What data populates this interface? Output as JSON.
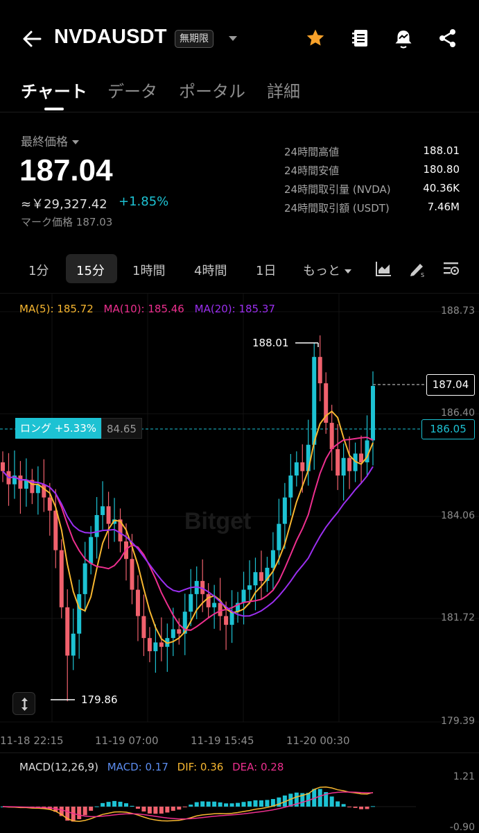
{
  "header": {
    "symbol": "NVDAUSDT",
    "badge": "無期限",
    "icons": [
      "back-arrow-icon",
      "star-icon",
      "notebook-icon",
      "alert-bell-icon",
      "share-icon"
    ]
  },
  "tabs": [
    {
      "label": "チャート",
      "active": true
    },
    {
      "label": "データ",
      "active": false
    },
    {
      "label": "ポータル",
      "active": false
    },
    {
      "label": "詳細",
      "active": false
    }
  ],
  "price": {
    "label": "最終価格",
    "last": "187.04",
    "approx": "≈￥29,327.42",
    "change": "+1.85%",
    "mark_label": "マーク価格",
    "mark_value": "187.03"
  },
  "stats": [
    {
      "label": "24時間高値",
      "value": "188.01"
    },
    {
      "label": "24時間安値",
      "value": "180.80"
    },
    {
      "label": "24時間取引量 (NVDA)",
      "value": "40.36K"
    },
    {
      "label": "24時間取引額 (USDT)",
      "value": "7.46M"
    }
  ],
  "intervals": {
    "items": [
      "1分",
      "15分",
      "1時間",
      "4時間",
      "1日",
      "もっと"
    ],
    "active": "15分"
  },
  "colors": {
    "up": "#1dc2d3",
    "down": "#f0616d",
    "ma5": "#f8b730",
    "ma10": "#ee2f8f",
    "ma20": "#9b2ff0",
    "macd_blue": "#5c8df0"
  },
  "chart": {
    "ma_legend": {
      "ma5": "MA(5): 185.72",
      "ma10": "MA(10): 185.46",
      "ma20": "MA(20): 185.37"
    },
    "y_ticks": [
      "188.73",
      "186.40",
      "184.06",
      "181.72",
      "179.39"
    ],
    "x_ticks": [
      "11-18 22:15",
      "11-19 07:00",
      "11-19 15:45",
      "11-20 00:30"
    ],
    "current_price": "187.04",
    "long_price": "186.05",
    "long_label": "ロング +5.33%",
    "long_qty": "84.65",
    "high_label": "188.01",
    "low_label": "179.86",
    "watermark": "Bitget"
  },
  "macd": {
    "label": "MACD(12,26,9)",
    "macd": "MACD: 0.17",
    "dif": "DIF: 0.36",
    "dea": "DEA: 0.28",
    "y_ticks": [
      "1.21",
      "-0.90"
    ]
  },
  "chart_data": {
    "type": "candlestick",
    "interval": "15分",
    "y_range": [
      179.39,
      188.73
    ],
    "closes": [
      185.1,
      184.8,
      185.0,
      184.7,
      184.9,
      184.6,
      184.8,
      184.5,
      184.2,
      183.3,
      182.0,
      180.9,
      181.4,
      182.3,
      183.0,
      183.6,
      184.1,
      184.3,
      183.9,
      184.0,
      183.5,
      183.1,
      182.4,
      181.8,
      181.3,
      181.0,
      181.2,
      181.1,
      181.3,
      181.5,
      181.4,
      181.9,
      182.3,
      182.6,
      182.3,
      182.0,
      182.1,
      181.8,
      181.6,
      181.9,
      182.1,
      182.4,
      182.5,
      182.8,
      182.6,
      182.9,
      183.3,
      183.9,
      184.5,
      185.0,
      185.3,
      185.1,
      185.7,
      187.7,
      187.1,
      186.2,
      185.6,
      185.0,
      185.4,
      185.1,
      185.5,
      185.3,
      185.8,
      187.04
    ]
  }
}
